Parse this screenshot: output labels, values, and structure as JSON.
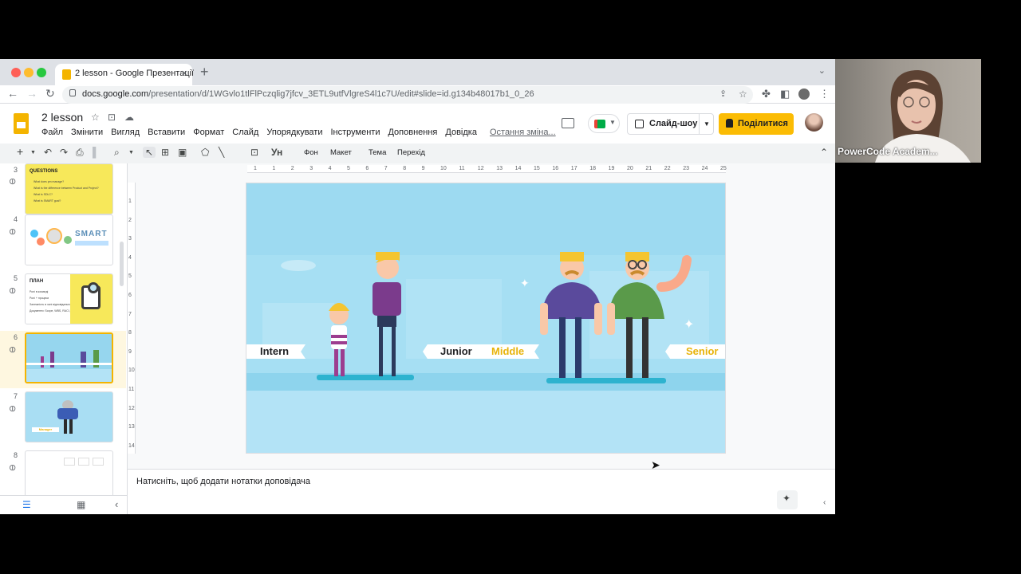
{
  "browser": {
    "tab_title": "2 lesson - Google Презентації",
    "tab_close": "×",
    "new_tab": "+",
    "url_domain": "docs.google.com",
    "url_path": "/presentation/d/1WGvlo1tlFlPczqlig7jfcv_3ETL9utfVlgreS4l1c7U/edit#slide=id.g134b48017b1_0_26"
  },
  "docs": {
    "title": "2 lesson",
    "menu": [
      "Файл",
      "Змінити",
      "Вигляд",
      "Вставити",
      "Формат",
      "Слайд",
      "Упорядкувати",
      "Інструменти",
      "Доповнення",
      "Довідка"
    ],
    "last_edit": "Остання зміна...",
    "slideshow_label": "Слайд-шоу",
    "share_label": "Поділитися"
  },
  "toolbar": {
    "background": "Фон",
    "layout": "Макет",
    "theme": "Тема",
    "transition": "Перехід"
  },
  "thumbnails": {
    "numbers": [
      "3",
      "4",
      "5",
      "6",
      "7",
      "8"
    ],
    "slide3_title": "QUESTIONS",
    "slide3_lines": [
      "What does pm manage?",
      "What is the difference between Product and Project?",
      "What is SDLC?",
      "What is SMART goal?"
    ],
    "slide4_word": "SMART",
    "slide5_title": "ПЛАН",
    "slide5_lines": [
      "Ролі в команді",
      "Ролі + процеси",
      "Залежність в зоні відповідальності",
      "Документи: Scope, WBS, RACI, PERT"
    ],
    "slide7_label": "Manager"
  },
  "ruler": {
    "h": [
      "1",
      "1",
      "2",
      "3",
      "4",
      "5",
      "6",
      "7",
      "8",
      "9",
      "10",
      "11",
      "12",
      "13",
      "14",
      "15",
      "16",
      "17",
      "18",
      "19",
      "20",
      "21",
      "22",
      "23",
      "24",
      "25"
    ],
    "v": [
      "1",
      "2",
      "3",
      "4",
      "5",
      "6",
      "7",
      "8",
      "9",
      "10",
      "11",
      "12",
      "13",
      "14"
    ]
  },
  "slide": {
    "labels": [
      "Intern",
      "Junior",
      "Middle",
      "Senior"
    ]
  },
  "notes": {
    "placeholder": "Натисніть, щоб додати нотатки доповідача"
  },
  "webcam": {
    "label": "PowerCode Academ..."
  },
  "colors": {
    "slide_bg": "#b3e3f6",
    "ground": "#7fd3ea",
    "accent_yellow": "#f4b400",
    "label_gold": "#e8b30a"
  }
}
